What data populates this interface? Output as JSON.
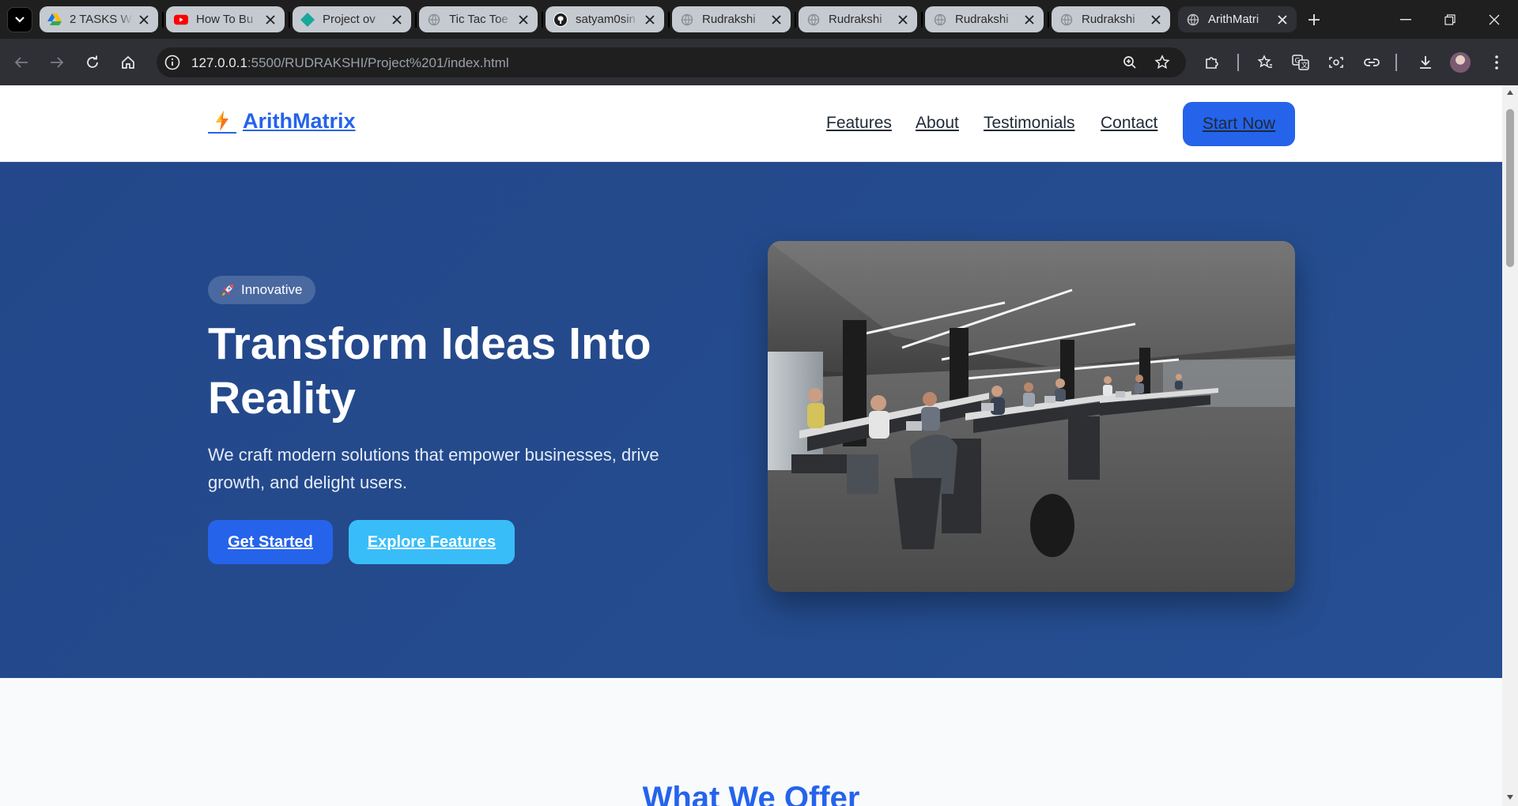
{
  "browser": {
    "tabs": [
      {
        "title": "2 TASKS W",
        "icon": "google-drive-icon"
      },
      {
        "title": "How To Bu",
        "icon": "youtube-icon"
      },
      {
        "title": "Project ov",
        "icon": "diamond-icon"
      },
      {
        "title": "Tic Tac Toe",
        "icon": "globe-icon"
      },
      {
        "title": "satyam0sin",
        "icon": "github-icon"
      },
      {
        "title": "Rudrakshi",
        "icon": "globe-icon"
      },
      {
        "title": "Rudrakshi",
        "icon": "globe-icon"
      },
      {
        "title": "Rudrakshi",
        "icon": "globe-icon"
      },
      {
        "title": "Rudrakshi",
        "icon": "globe-icon"
      },
      {
        "title": "ArithMatri",
        "icon": "globe-icon",
        "active": true
      }
    ],
    "url_host": "127.0.0.1",
    "url_path": ":5500/RUDRAKSHI/Project%201/index.html"
  },
  "site": {
    "brand": "ArithMatrix",
    "nav": {
      "features": "Features",
      "about": "About",
      "testimonials": "Testimonials",
      "contact": "Contact",
      "start": "Start Now"
    },
    "hero": {
      "badge": "Innovative",
      "title": "Transform Ideas Into Reality",
      "subtitle": "We craft modern solutions that empower businesses, drive growth, and delight users.",
      "primary_cta": "Get Started",
      "secondary_cta": "Explore Features"
    },
    "offer_title": "What We Offer"
  },
  "colors": {
    "brand_blue": "#2563eb",
    "hero_bg": "#244c8e",
    "accent_sky": "#38bdf8"
  }
}
